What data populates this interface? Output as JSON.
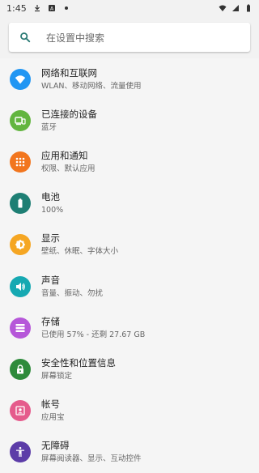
{
  "status_bar": {
    "time": "1:45",
    "left_icons": [
      "download-icon",
      "sim-alert-icon",
      "notification-dot-icon"
    ],
    "right_icons": [
      "wifi-icon",
      "signal-icon",
      "battery-icon"
    ]
  },
  "search": {
    "placeholder": "在设置中搜索",
    "icon": "search-icon",
    "icon_color": "#2a7a74"
  },
  "settings": [
    {
      "key": "network",
      "title": "网络和互联网",
      "subtitle": "WLAN、移动网络、流量使用",
      "icon": "wifi-icon",
      "color": "#2196f3"
    },
    {
      "key": "connected-devices",
      "title": "已连接的设备",
      "subtitle": "蓝牙",
      "icon": "devices-icon",
      "color": "#62b53f"
    },
    {
      "key": "apps",
      "title": "应用和通知",
      "subtitle": "权限、默认应用",
      "icon": "apps-grid-icon",
      "color": "#f2761e"
    },
    {
      "key": "battery",
      "title": "电池",
      "subtitle": "100%",
      "icon": "battery-icon",
      "color": "#1e7f74"
    },
    {
      "key": "display",
      "title": "显示",
      "subtitle": "壁纸、休眠、字体大小",
      "icon": "brightness-icon",
      "color": "#f5a623"
    },
    {
      "key": "sound",
      "title": "声音",
      "subtitle": "音量、振动、勿扰",
      "icon": "volume-icon",
      "color": "#16a9b2"
    },
    {
      "key": "storage",
      "title": "存储",
      "subtitle": "已使用 57% - 还剩 27.67 GB",
      "icon": "storage-icon",
      "color": "#b657d9"
    },
    {
      "key": "security",
      "title": "安全性和位置信息",
      "subtitle": "屏幕锁定",
      "icon": "lock-icon",
      "color": "#2e8b3b"
    },
    {
      "key": "accounts",
      "title": "帐号",
      "subtitle": "应用宝",
      "icon": "account-icon",
      "color": "#e55b8c"
    },
    {
      "key": "accessibility",
      "title": "无障碍",
      "subtitle": "屏幕阅读器、显示、互动控件",
      "icon": "accessibility-icon",
      "color": "#5c3ca8"
    }
  ]
}
